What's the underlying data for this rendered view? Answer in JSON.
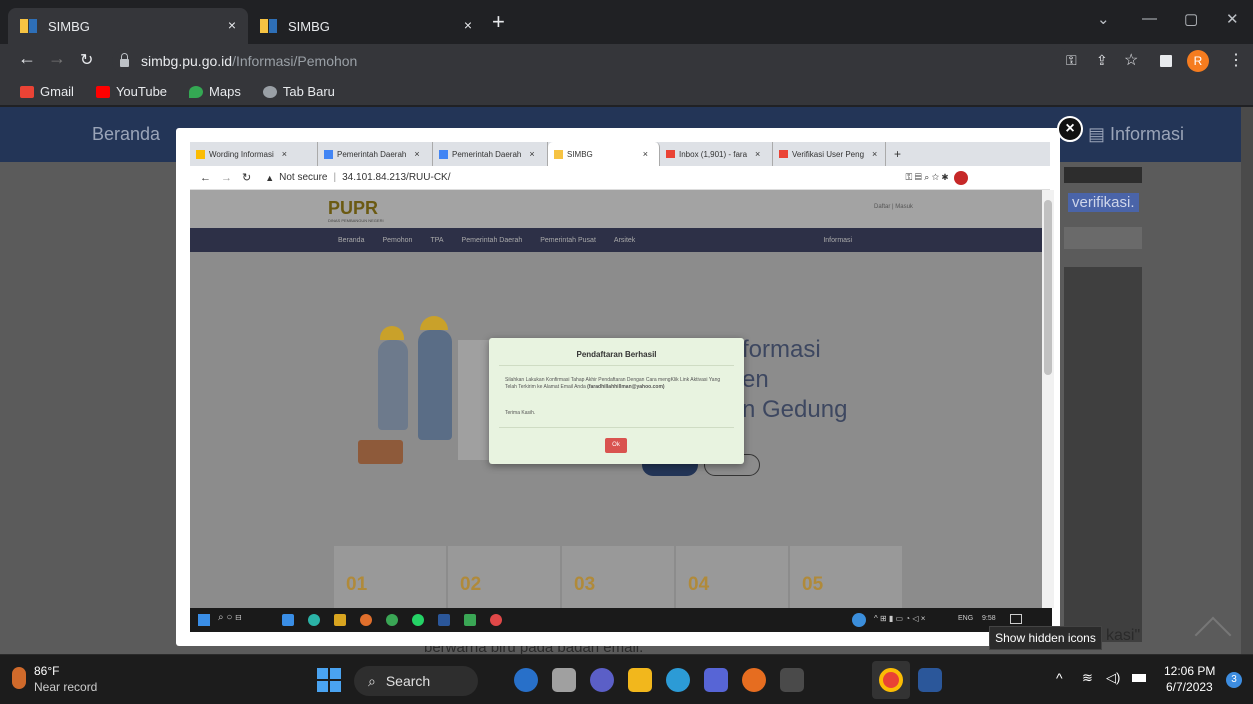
{
  "browser": {
    "tabs": [
      {
        "title": "SIMBG",
        "close": "×"
      },
      {
        "title": "SIMBG",
        "close": "×"
      }
    ],
    "new_tab": "+",
    "window_controls": {
      "minimize": "—",
      "restore": "▢",
      "close": "✕",
      "dropdown": "⌄"
    },
    "url_host": "simbg.pu.go.id",
    "url_path": "/Informasi/Pemohon",
    "profile_initial": "R",
    "bookmarks": [
      {
        "label": "Gmail",
        "icon": "gmail-icon",
        "color": "#ea4335"
      },
      {
        "label": "YouTube",
        "icon": "youtube-icon",
        "color": "#ff0000"
      },
      {
        "label": "Maps",
        "icon": "maps-icon",
        "color": "#34a853"
      },
      {
        "label": "Tab Baru",
        "icon": "chrome-icon",
        "color": "#9aa0a6"
      }
    ]
  },
  "page": {
    "nav_home": "Beranda",
    "nav_info": "Informasi",
    "bg_text_verifikasi": "verifikasi.",
    "bg_text_bottom": "berwarna biru pada badan email.",
    "bg_text_right": "kasi\""
  },
  "screenshot_overlay": {
    "close": "×",
    "tabs": [
      {
        "title": "Wording Informasi",
        "close": "×"
      },
      {
        "title": "Pemerintah Daerah",
        "close": "×"
      },
      {
        "title": "Pemerintah Daerah",
        "close": "×"
      },
      {
        "title": "SIMBG",
        "close": "×"
      },
      {
        "title": "Inbox (1,901) - fara",
        "close": "×"
      },
      {
        "title": "Verifikasi User Peng",
        "close": "×"
      }
    ],
    "inner_new_tab": "+",
    "not_secure": "Not secure",
    "inner_url": "34.101.84.213/RUU-CK/",
    "logo_text": "PUPR",
    "logo_sub": "DINAS PEMBANGUN NEGERI",
    "header_links": "Daftar | Masuk",
    "inner_nav": [
      "Beranda",
      "Pemohon",
      "TPA",
      "Pemerintah Daerah",
      "Pemerintah Pusat",
      "Arsitek"
    ],
    "inner_nav_info": "Informasi",
    "hero_lines": [
      "formasi",
      "en",
      "n Gedung"
    ],
    "cards": [
      "01",
      "02",
      "03",
      "04",
      "05"
    ],
    "inner_tray_time": "9:58",
    "inner_tray_lang": "ENG"
  },
  "modal": {
    "title": "Pendaftaran Berhasil",
    "message": "Silahkan Lakukan Konfirmasi Tahap Akhir Pendaftaran Dengan Cara mengKlik Link Aktivasi Yang Telah Terkirim ke Alamat Email Anda",
    "email": "(faradhillahhillman@yahoo.com)",
    "thanks": "Terima Kasih.",
    "ok": "Ok"
  },
  "tooltip": "Show hidden icons",
  "taskbar": {
    "weather_temp": "86°F",
    "weather_desc": "Near record",
    "search": "Search",
    "time": "12:06 PM",
    "date": "6/7/2023",
    "notifications": "3"
  }
}
